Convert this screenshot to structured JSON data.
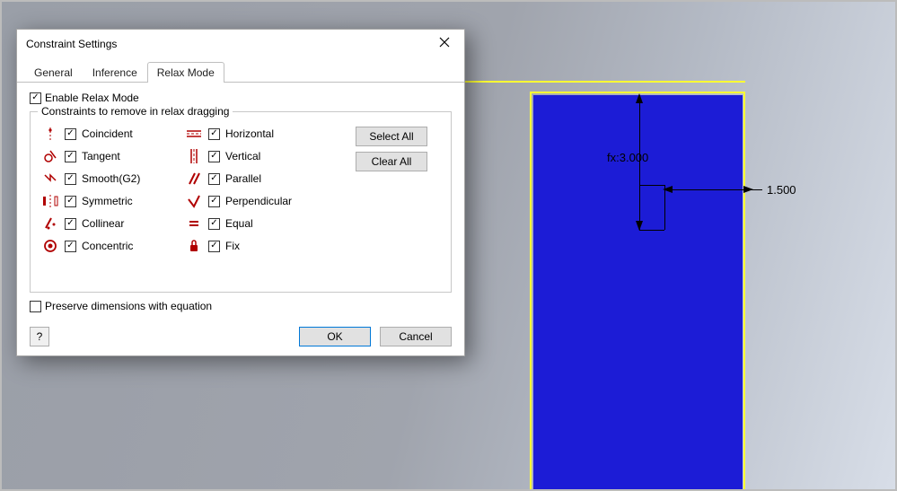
{
  "dialog": {
    "title": "Constraint Settings",
    "tabs": [
      "General",
      "Inference",
      "Relax Mode"
    ],
    "active_tab": 2,
    "enable_relax_label": "Enable Relax Mode",
    "group_legend": "Constraints to remove in relax dragging",
    "col1": [
      {
        "label": "Coincident",
        "icon": "coincident"
      },
      {
        "label": "Tangent",
        "icon": "tangent"
      },
      {
        "label": "Smooth(G2)",
        "icon": "smooth"
      },
      {
        "label": "Symmetric",
        "icon": "symmetric"
      },
      {
        "label": "Collinear",
        "icon": "collinear"
      },
      {
        "label": "Concentric",
        "icon": "concentric"
      }
    ],
    "col2": [
      {
        "label": "Horizontal",
        "icon": "horizontal"
      },
      {
        "label": "Vertical",
        "icon": "vertical"
      },
      {
        "label": "Parallel",
        "icon": "parallel"
      },
      {
        "label": "Perpendicular",
        "icon": "perpendicular"
      },
      {
        "label": "Equal",
        "icon": "equal"
      },
      {
        "label": "Fix",
        "icon": "fix"
      }
    ],
    "select_all": "Select All",
    "clear_all": "Clear All",
    "preserve_label": "Preserve dimensions with equation",
    "help": "?",
    "ok": "OK",
    "cancel": "Cancel"
  },
  "cad": {
    "dim1": "fx:3.000",
    "dim2": "1.500"
  }
}
